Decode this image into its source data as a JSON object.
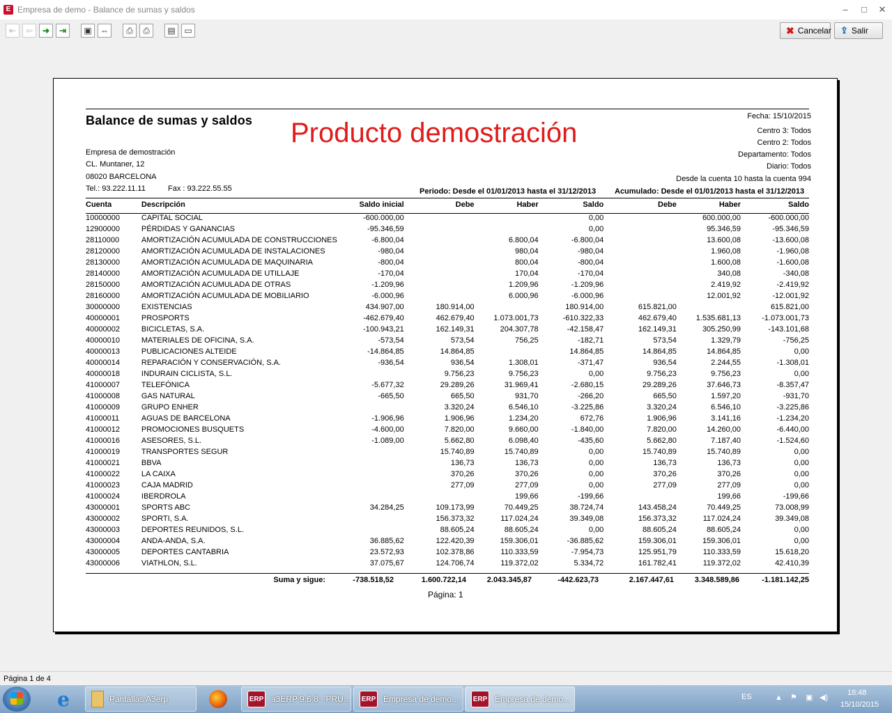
{
  "window": {
    "title": "Empresa de demo - Balance de sumas y saldos",
    "minimize": "‒",
    "maximize": "□",
    "close": "✕"
  },
  "toolbar": {
    "cancel_label": "Cancelar",
    "exit_label": "Salir"
  },
  "report": {
    "title": "Balance de sumas y saldos",
    "watermark": "Producto demostración",
    "company": {
      "name": "Empresa de demostración",
      "address": "CL. Muntaner, 12",
      "city": "08020 BARCELONA",
      "phone": "Tel.: 93.222.11.11",
      "fax": "Fax : 93.222.55.55"
    },
    "meta": {
      "fecha": "Fecha: 15/10/2015",
      "centro3": "Centro 3: Todos",
      "centro2": "Centro 2: Todos",
      "departamento": "Departamento: Todos",
      "diario": "Diario: Todos",
      "cuentas": "Desde la cuenta 10 hasta la cuenta 994"
    },
    "periodo": "Periodo: Desde el 01/01/2013 hasta el 31/12/2013",
    "acumulado": "Acumulado: Desde el 01/01/2013 hasta el 31/12/2013",
    "columns": [
      "Cuenta",
      "Descripción",
      "Saldo inicial",
      "Debe",
      "Haber",
      "Saldo",
      "Debe",
      "Haber",
      "Saldo"
    ],
    "rows": [
      [
        "10000000",
        "CAPITAL SOCIAL",
        "-600.000,00",
        "",
        "",
        "0,00",
        "",
        "600.000,00",
        "-600.000,00"
      ],
      [
        "12900000",
        "PÉRDIDAS Y GANANCIAS",
        "-95.346,59",
        "",
        "",
        "0,00",
        "",
        "95.346,59",
        "-95.346,59"
      ],
      [
        "28110000",
        "AMORTIZACIÓN ACUMULADA DE CONSTRUCCIONES",
        "-6.800,04",
        "",
        "6.800,04",
        "-6.800,04",
        "",
        "13.600,08",
        "-13.600,08"
      ],
      [
        "28120000",
        "AMORTIZACIÓN ACUMULADA DE INSTALACIONES",
        "-980,04",
        "",
        "980,04",
        "-980,04",
        "",
        "1.960,08",
        "-1.960,08"
      ],
      [
        "28130000",
        "AMORTIZACIÓN ACUMULADA DE MAQUINARIA",
        "-800,04",
        "",
        "800,04",
        "-800,04",
        "",
        "1.600,08",
        "-1.600,08"
      ],
      [
        "28140000",
        "AMORTIZACIÓN ACUMULADA DE UTILLAJE",
        "-170,04",
        "",
        "170,04",
        "-170,04",
        "",
        "340,08",
        "-340,08"
      ],
      [
        "28150000",
        "AMORTIZACIÓN ACUMULADA DE OTRAS",
        "-1.209,96",
        "",
        "1.209,96",
        "-1.209,96",
        "",
        "2.419,92",
        "-2.419,92"
      ],
      [
        "28160000",
        "AMORTIZACIÓN ACUMULADA DE MOBILIARIO",
        "-6.000,96",
        "",
        "6.000,96",
        "-6.000,96",
        "",
        "12.001,92",
        "-12.001,92"
      ],
      [
        "30000000",
        "EXISTENCIAS",
        "434.907,00",
        "180.914,00",
        "",
        "180.914,00",
        "615.821,00",
        "",
        "615.821,00"
      ],
      [
        "40000001",
        "PROSPORTS",
        "-462.679,40",
        "462.679,40",
        "1.073.001,73",
        "-610.322,33",
        "462.679,40",
        "1.535.681,13",
        "-1.073.001,73"
      ],
      [
        "40000002",
        "BICICLETAS, S.A.",
        "-100.943,21",
        "162.149,31",
        "204.307,78",
        "-42.158,47",
        "162.149,31",
        "305.250,99",
        "-143.101,68"
      ],
      [
        "40000010",
        "MATERIALES DE OFICINA, S.A.",
        "-573,54",
        "573,54",
        "756,25",
        "-182,71",
        "573,54",
        "1.329,79",
        "-756,25"
      ],
      [
        "40000013",
        "PUBLICACIONES ALTEIDE",
        "-14.864,85",
        "14.864,85",
        "",
        "14.864,85",
        "14.864,85",
        "14.864,85",
        "0,00"
      ],
      [
        "40000014",
        "REPARACIÓN Y CONSERVACIÓN, S.A.",
        "-936,54",
        "936,54",
        "1.308,01",
        "-371,47",
        "936,54",
        "2.244,55",
        "-1.308,01"
      ],
      [
        "40000018",
        "INDURAIN CICLISTA, S.L.",
        "",
        "9.756,23",
        "9.756,23",
        "0,00",
        "9.756,23",
        "9.756,23",
        "0,00"
      ],
      [
        "41000007",
        "TELEFÓNICA",
        "-5.677,32",
        "29.289,26",
        "31.969,41",
        "-2.680,15",
        "29.289,26",
        "37.646,73",
        "-8.357,47"
      ],
      [
        "41000008",
        "GAS NATURAL",
        "-665,50",
        "665,50",
        "931,70",
        "-266,20",
        "665,50",
        "1.597,20",
        "-931,70"
      ],
      [
        "41000009",
        "GRUPO ENHER",
        "",
        "3.320,24",
        "6.546,10",
        "-3.225,86",
        "3.320,24",
        "6.546,10",
        "-3.225,86"
      ],
      [
        "41000011",
        "AGUAS DE BARCELONA",
        "-1.906,96",
        "1.906,96",
        "1.234,20",
        "672,76",
        "1.906,96",
        "3.141,16",
        "-1.234,20"
      ],
      [
        "41000012",
        "PROMOCIONES BUSQUETS",
        "-4.600,00",
        "7.820,00",
        "9.660,00",
        "-1.840,00",
        "7.820,00",
        "14.260,00",
        "-6.440,00"
      ],
      [
        "41000016",
        "ASESORES, S.L.",
        "-1.089,00",
        "5.662,80",
        "6.098,40",
        "-435,60",
        "5.662,80",
        "7.187,40",
        "-1.524,60"
      ],
      [
        "41000019",
        "TRANSPORTES SEGUR",
        "",
        "15.740,89",
        "15.740,89",
        "0,00",
        "15.740,89",
        "15.740,89",
        "0,00"
      ],
      [
        "41000021",
        "BBVA",
        "",
        "136,73",
        "136,73",
        "0,00",
        "136,73",
        "136,73",
        "0,00"
      ],
      [
        "41000022",
        "LA CAIXA",
        "",
        "370,26",
        "370,26",
        "0,00",
        "370,26",
        "370,26",
        "0,00"
      ],
      [
        "41000023",
        "CAJA MADRID",
        "",
        "277,09",
        "277,09",
        "0,00",
        "277,09",
        "277,09",
        "0,00"
      ],
      [
        "41000024",
        "IBERDROLA",
        "",
        "",
        "199,66",
        "-199,66",
        "",
        "199,66",
        "-199,66"
      ],
      [
        "43000001",
        "SPORTS ABC",
        "34.284,25",
        "109.173,99",
        "70.449,25",
        "38.724,74",
        "143.458,24",
        "70.449,25",
        "73.008,99"
      ],
      [
        "43000002",
        "SPORTI, S.A.",
        "",
        "156.373,32",
        "117.024,24",
        "39.349,08",
        "156.373,32",
        "117.024,24",
        "39.349,08"
      ],
      [
        "43000003",
        "DEPORTES REUNIDOS, S.L.",
        "",
        "88.605,24",
        "88.605,24",
        "0,00",
        "88.605,24",
        "88.605,24",
        "0,00"
      ],
      [
        "43000004",
        "ANDA-ANDA, S.A.",
        "36.885,62",
        "122.420,39",
        "159.306,01",
        "-36.885,62",
        "159.306,01",
        "159.306,01",
        "0,00"
      ],
      [
        "43000005",
        "DEPORTES CANTABRIA",
        "23.572,93",
        "102.378,86",
        "110.333,59",
        "-7.954,73",
        "125.951,79",
        "110.333,59",
        "15.618,20"
      ],
      [
        "43000006",
        "VIATHLON, S.L.",
        "37.075,67",
        "124.706,74",
        "119.372,02",
        "5.334,72",
        "161.782,41",
        "119.372,02",
        "42.410,39"
      ]
    ],
    "totals": {
      "label": "Suma y sigue:",
      "values": [
        "-738.518,52",
        "1.600.722,14",
        "2.043.345,87",
        "-442.623,73",
        "2.167.447,61",
        "3.348.589,86",
        "-1.181.142,25"
      ]
    },
    "page": "Página: 1"
  },
  "status": {
    "text": "Página 1 de 4"
  },
  "taskbar": {
    "items": [
      {
        "label": "Pantallas A3erp"
      },
      {
        "label": "a3ERP 9.6.8 - PRU..."
      },
      {
        "label": "Empresa de demo..."
      },
      {
        "label": "Empresa de demo..."
      }
    ],
    "erp_badge": "ERP",
    "lang": "ES",
    "time": "18:48",
    "date": "15/10/2015"
  }
}
